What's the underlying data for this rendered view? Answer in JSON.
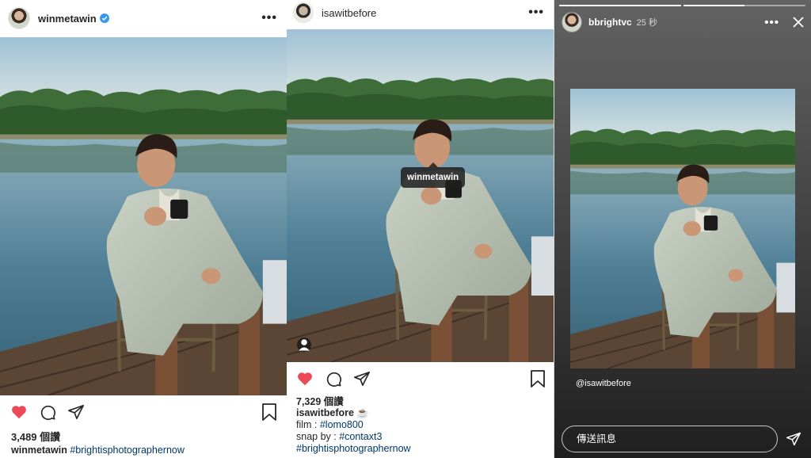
{
  "post1": {
    "username": "winmetawin",
    "verified": true,
    "likes": "3,489 個讚",
    "caption_user": "winmetawin",
    "caption_tag": "#brightisphotographernow",
    "icons": [
      "heart-icon",
      "comment-icon",
      "share-icon",
      "bookmark-icon"
    ],
    "heart_color": "#ed4956"
  },
  "post2": {
    "username": "isawitbefore",
    "tag_label": "winmetawin",
    "likes": "7,329 個讚",
    "caption_user": "isawitbefore",
    "caption_emoji": "☕",
    "line2_prefix": "film : ",
    "line2_tag": "#lomo800",
    "line3_prefix": "snap by : ",
    "line3_tag": "#contaxt3",
    "line4_tag": "#brightisphotographernow"
  },
  "story": {
    "username": "bbrightvc",
    "time": "25 秒",
    "mention": "@isawitbefore",
    "reply_placeholder": "傳送訊息",
    "progress": [
      1.0,
      0.5
    ]
  }
}
